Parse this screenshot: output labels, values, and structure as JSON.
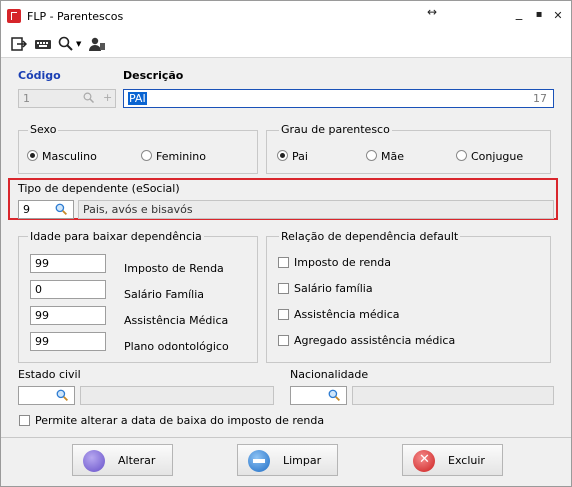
{
  "window": {
    "title": "FLP - Parentescos",
    "resize_glyph": "↔",
    "min_glyph": "_",
    "max_glyph": "▪",
    "close_glyph": "✕"
  },
  "toolbar": {
    "icons": [
      "exit-icon",
      "keyboard-icon",
      "search-icon",
      "user-icon"
    ]
  },
  "main": {
    "codigo_label": "Código",
    "codigo_value": "1",
    "descricao_label": "Descrição",
    "descricao_value": "PAI",
    "descricao_max": "17"
  },
  "sexo": {
    "title": "Sexo",
    "options": [
      "Masculino",
      "Feminino"
    ],
    "selected": "Masculino"
  },
  "grau": {
    "title": "Grau de parentesco",
    "options": [
      "Pai",
      "Mãe",
      "Conjugue"
    ],
    "selected": "Pai"
  },
  "tipo_dependente": {
    "title": "Tipo de dependente (eSocial)",
    "code": "9",
    "description": "Pais, avós e bisavós"
  },
  "idade": {
    "title": "Idade para baixar dependência",
    "rows": [
      {
        "value": "99",
        "label": "Imposto de Renda"
      },
      {
        "value": "0",
        "label": "Salário Família"
      },
      {
        "value": "99",
        "label": "Assistência Médica"
      },
      {
        "value": "99",
        "label": "Plano odontológico"
      }
    ]
  },
  "relacao": {
    "title": "Relação de dependência default",
    "items": [
      "Imposto de renda",
      "Salário família",
      "Assistência médica",
      "Agregado assistência médica"
    ]
  },
  "estado_civil": {
    "label": "Estado civil"
  },
  "nacionalidade": {
    "label": "Nacionalidade"
  },
  "permite": {
    "label": "Permite alterar a data de baixa do imposto de renda"
  },
  "buttons": {
    "alterar": "Alterar",
    "limpar": "Limpar",
    "excluir": "Excluir"
  },
  "colors": {
    "highlight": "#d9262c",
    "link_blue": "#1a3fb4",
    "selection": "#0a64d2"
  }
}
